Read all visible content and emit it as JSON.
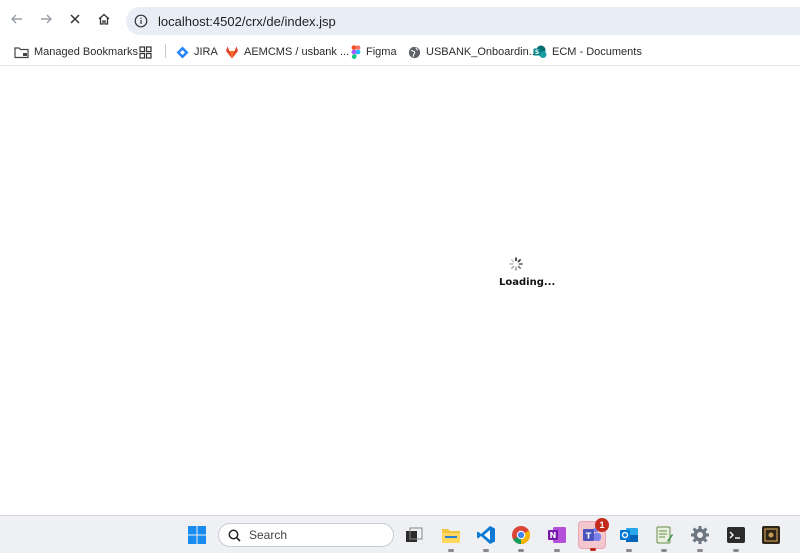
{
  "browser": {
    "address_url": "localhost:4502/crx/de/index.jsp"
  },
  "bookmarks": {
    "managed": "Managed Bookmarks",
    "items": [
      {
        "label": "JIRA",
        "icon": "jira-icon"
      },
      {
        "label": "AEMCMS / usbank ...",
        "icon": "gitlab-icon"
      },
      {
        "label": "Figma",
        "icon": "figma-icon"
      },
      {
        "label": "USBANK_Onboardin...",
        "icon": "globe-icon"
      },
      {
        "label": "ECM - Documents",
        "icon": "sharepoint-icon"
      }
    ]
  },
  "page": {
    "loading_text": "Loading..."
  },
  "taskbar": {
    "search_label": "Search",
    "teams_badge": "1",
    "apps": [
      "start-icon",
      "search",
      "task-view-icon",
      "file-explorer-icon",
      "vscode-icon",
      "chrome-icon",
      "onenote-icon",
      "teams-icon",
      "outlook-icon",
      "notepad-icon",
      "settings-icon",
      "terminal-icon",
      "app-icon"
    ]
  },
  "colors": {
    "address_bg": "#e9eef6",
    "teams_highlight": "#f4c7cf",
    "badge": "#c42b1c"
  }
}
